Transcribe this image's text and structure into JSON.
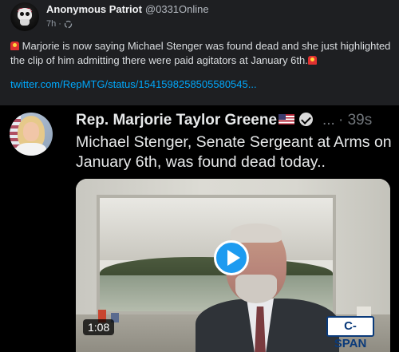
{
  "outer_post": {
    "author_name": "Anonymous Patriot",
    "author_handle": "@0331Online",
    "time": "7h",
    "text": "Marjorie is now saying Michael Stenger was found dead and she just highlighted the clip of him admitting there were paid agitators at January 6th.",
    "link": "twitter.com/RepMTG/status/1541598258505580545..."
  },
  "embedded_tweet": {
    "author_name": "Rep. Marjorie Taylor Greene",
    "more": "...",
    "time": "· 39s",
    "text": "Michael Stenger, Senate Sergeant at Arms on January 6th, was found dead today..",
    "video": {
      "duration": "1:08",
      "logo": "C-SPAN"
    }
  },
  "colors": {
    "link": "#00a8fc",
    "play_button": "#1d9bf0",
    "background": "#1e1f22"
  }
}
